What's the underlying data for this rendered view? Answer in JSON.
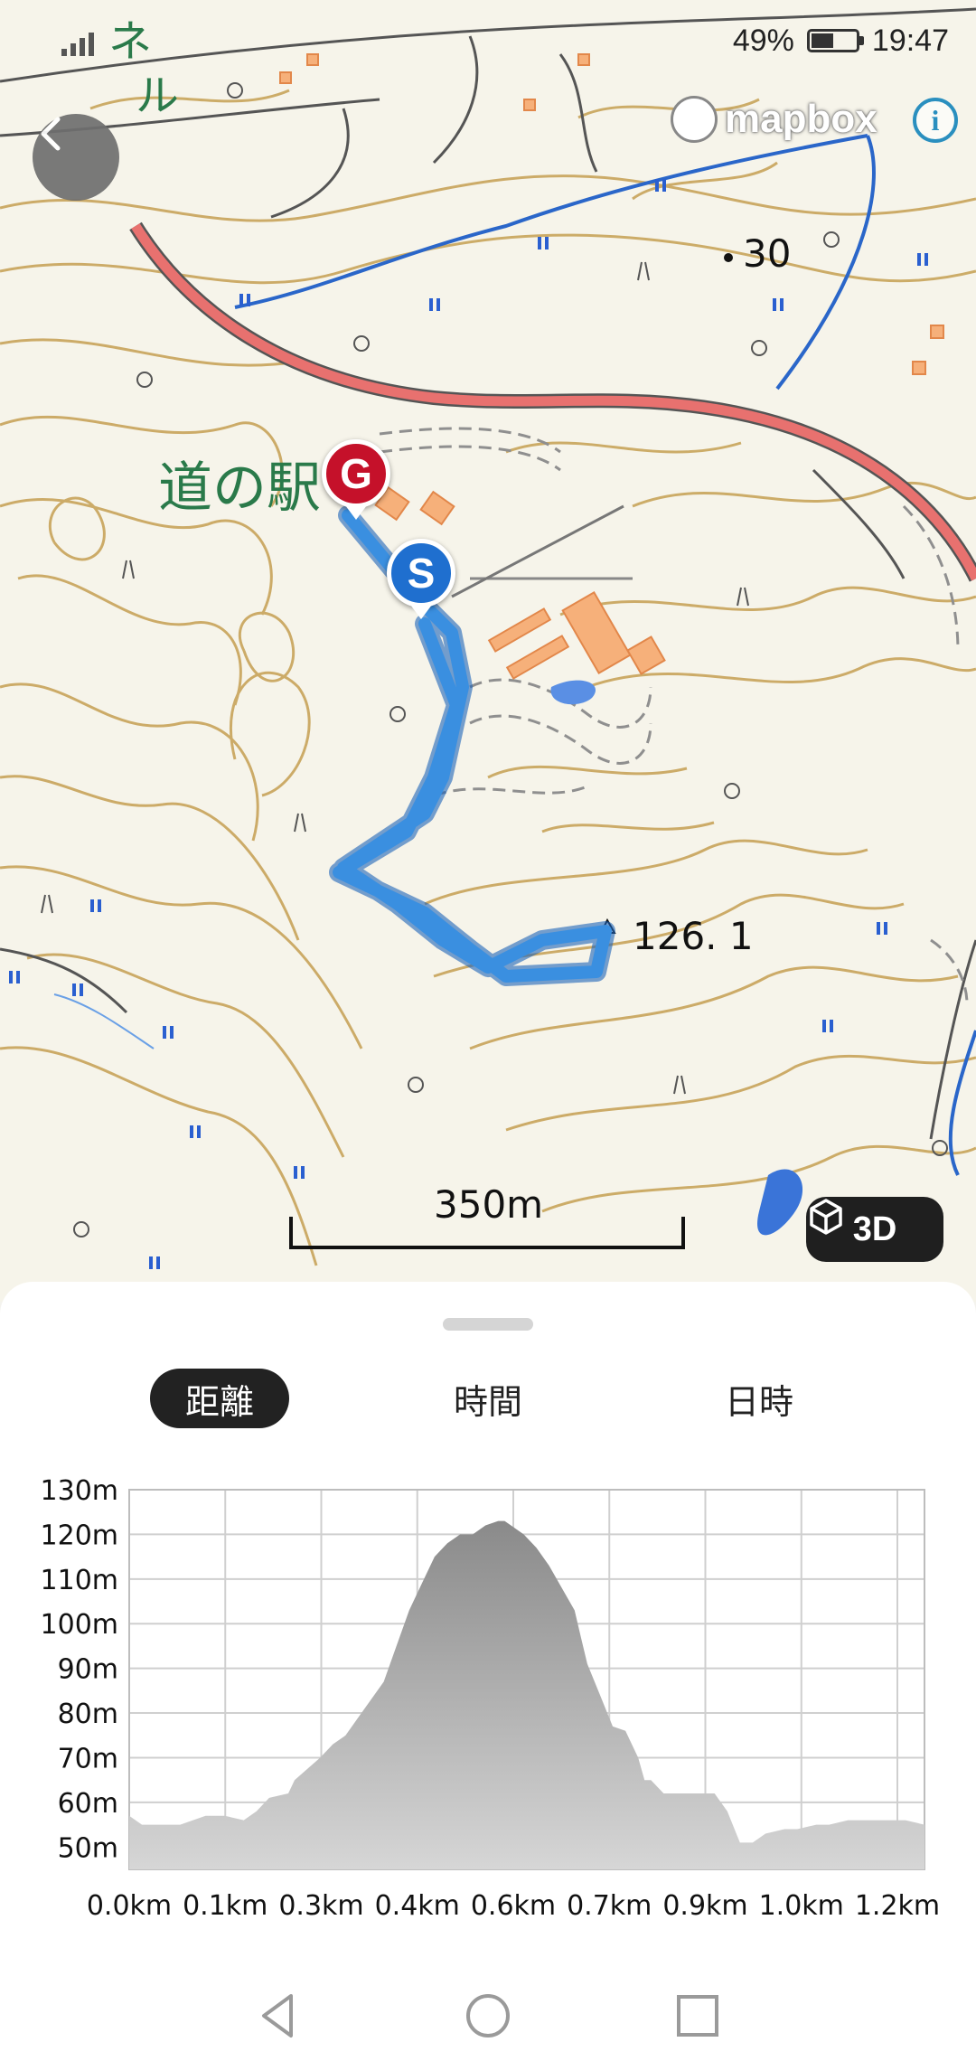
{
  "status_bar": {
    "battery": "49%",
    "battery_level": 0.49,
    "time": "19:47"
  },
  "map": {
    "attribution": "mapbox",
    "info_label": "i",
    "labels": {
      "place": "道の駅",
      "spot_height": "126. 1",
      "height_30": "30",
      "tunnel_chars": [
        "ネ",
        "ル"
      ]
    },
    "scale_label": "350m",
    "btn_3d_label": "3D",
    "goal_marker": "G",
    "start_marker": "S",
    "colors": {
      "road": "#e8716f",
      "route": "#3a8fe0",
      "contour": "#c8a45a",
      "water": "#2a66c9"
    }
  },
  "tabs": [
    {
      "label": "距離",
      "active": true
    },
    {
      "label": "時間",
      "active": false
    },
    {
      "label": "日時",
      "active": false
    }
  ],
  "chart_data": {
    "type": "area",
    "xlabel": "",
    "ylabel": "",
    "x_ticks": [
      "0.0km",
      "0.1km",
      "0.3km",
      "0.4km",
      "0.6km",
      "0.7km",
      "0.9km",
      "1.0km",
      "1.2km"
    ],
    "y_ticks": [
      "130m",
      "120m",
      "110m",
      "100m",
      "90m",
      "80m",
      "70m",
      "60m",
      "50m"
    ],
    "ylim": [
      45,
      130
    ],
    "xlim": [
      0,
      1.25
    ],
    "grid": true,
    "series": [
      {
        "x": [
          0.0,
          0.02,
          0.05,
          0.08,
          0.12,
          0.15,
          0.18,
          0.2,
          0.22,
          0.25,
          0.26,
          0.3,
          0.32,
          0.34,
          0.36,
          0.38,
          0.4,
          0.42,
          0.44,
          0.46,
          0.48,
          0.5,
          0.52,
          0.54,
          0.56,
          0.58,
          0.59,
          0.6,
          0.62,
          0.64,
          0.66,
          0.68,
          0.7,
          0.71,
          0.72,
          0.74,
          0.76,
          0.78,
          0.8,
          0.81,
          0.82,
          0.84,
          0.86,
          0.88,
          0.9,
          0.92,
          0.94,
          0.96,
          0.98,
          1.0,
          1.03,
          1.05,
          1.08,
          1.1,
          1.13,
          1.16,
          1.19,
          1.22,
          1.25
        ],
        "y": [
          57,
          55,
          55,
          55,
          57,
          57,
          56,
          58,
          61,
          62,
          65,
          70,
          73,
          75,
          79,
          83,
          87,
          95,
          103,
          109,
          115,
          118,
          120,
          120,
          122,
          123,
          123,
          122,
          120,
          117,
          113,
          108,
          103,
          97,
          91,
          84,
          77,
          76,
          70,
          65,
          65,
          62,
          62,
          62,
          62,
          62,
          58,
          51,
          51,
          53,
          54,
          54,
          55,
          55,
          56,
          56,
          56,
          56,
          55
        ],
        "fill": "#9a9a9a"
      }
    ]
  }
}
